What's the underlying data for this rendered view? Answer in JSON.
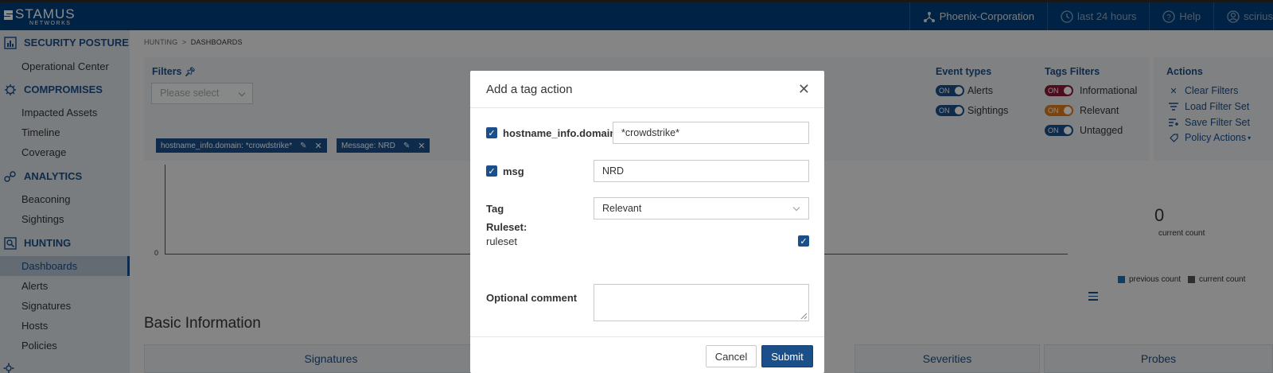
{
  "header": {
    "logo_main": "STAMUS",
    "logo_sub": "NETWORKS",
    "tenant": "Phoenix-Corporation",
    "time_range": "last 24 hours",
    "help": "Help",
    "user": "scirius"
  },
  "sidebar": {
    "sections": [
      {
        "title": "SECURITY POSTURE",
        "icon": "bar-chart-icon",
        "items": [
          "Operational Center"
        ]
      },
      {
        "title": "COMPROMISES",
        "icon": "bug-icon",
        "items": [
          "Impacted Assets",
          "Timeline",
          "Coverage"
        ]
      },
      {
        "title": "ANALYTICS",
        "icon": "analytics-icon",
        "items": [
          "Beaconing",
          "Sightings"
        ]
      },
      {
        "title": "HUNTING",
        "icon": "hunting-icon",
        "items": [
          "Dashboards",
          "Alerts",
          "Signatures",
          "Hosts",
          "Policies"
        ]
      }
    ],
    "active_item": "Dashboards"
  },
  "breadcrumb": {
    "parent": "HUNTING",
    "separator": ">",
    "current": "DASHBOARDS"
  },
  "filters": {
    "title": "Filters",
    "placeholder": "Please select",
    "chips": [
      "hostname_info.domain: *crowdstrike*",
      "Message: NRD"
    ]
  },
  "event_types": {
    "title": "Event types",
    "items": [
      {
        "state": "ON",
        "label": "Alerts"
      },
      {
        "state": "ON",
        "label": "Sightings"
      }
    ]
  },
  "tags_filters": {
    "title": "Tags Filters",
    "items": [
      {
        "state": "ON",
        "label": "Informational",
        "color": "#8b1a3a"
      },
      {
        "state": "ON",
        "label": "Relevant",
        "color": "#e07b1a"
      },
      {
        "state": "ON",
        "label": "Untagged",
        "color": "#1a4f8a"
      }
    ]
  },
  "actions": {
    "title": "Actions",
    "items": [
      {
        "icon": "close-icon",
        "label": "Clear Filters"
      },
      {
        "icon": "filter-icon",
        "label": "Load Filter Set"
      },
      {
        "icon": "save-filter-icon",
        "label": "Save Filter Set"
      },
      {
        "icon": "tag-icon",
        "label": "Policy Actions"
      }
    ]
  },
  "chart": {
    "y_zero": "0",
    "current_count": "0",
    "current_count_label": "current count",
    "legend": [
      {
        "label": "previous count",
        "color": "#1a6fc4"
      },
      {
        "label": "current count",
        "color": "#555555"
      }
    ]
  },
  "basic_info": {
    "title": "Basic Information",
    "tabs": [
      "Signatures",
      "Severities",
      "Probes"
    ]
  },
  "modal": {
    "title": "Add a tag action",
    "fields": [
      {
        "label": "hostname_info.domain",
        "value": "*crowdstrike*",
        "checked": true
      },
      {
        "label": "msg",
        "value": "NRD",
        "checked": true
      }
    ],
    "tag_label": "Tag",
    "tag_value": "Relevant",
    "ruleset_label": "Ruleset:",
    "ruleset_name": "ruleset",
    "comment_label": "Optional comment",
    "cancel": "Cancel",
    "submit": "Submit"
  },
  "colors": {
    "brand": "#003f7d",
    "accent": "#1a4f8a"
  }
}
